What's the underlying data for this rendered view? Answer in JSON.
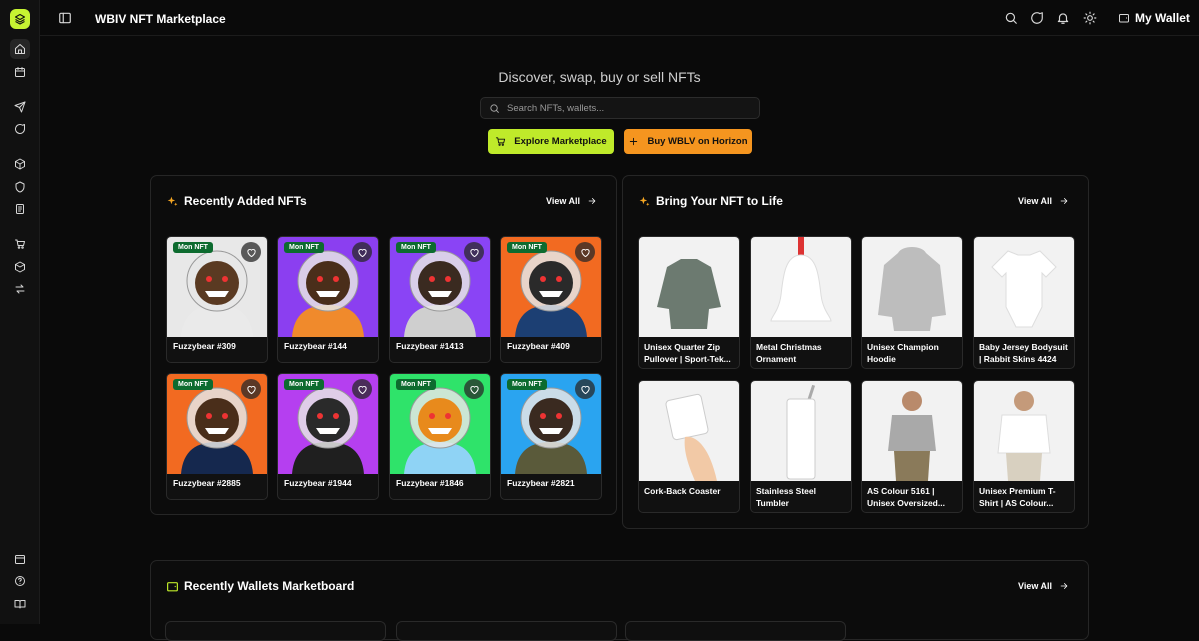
{
  "app": {
    "title": "WBIV NFT Marketplace",
    "wallet_label": "My Wallet"
  },
  "hero": {
    "title": "Discover, swap, buy or sell NFTs",
    "search_placeholder": "Search NFTs, wallets...",
    "explore_label": "Explore Marketplace",
    "buy_label": "Buy WBLV on Horizon"
  },
  "recent_nfts": {
    "title": "Recently Added NFTs",
    "view_all": "View All",
    "items": [
      {
        "name": "Fuzzybear #309",
        "badge": "Mon NFT",
        "bg": "#e8e8e8",
        "color": "#5a3a22",
        "suit": "#eaeaea"
      },
      {
        "name": "Fuzzybear #144",
        "badge": "Mon NFT",
        "bg": "#8b3ff0",
        "color": "#4a2e1a",
        "suit": "#f08a2c"
      },
      {
        "name": "Fuzzybear #1413",
        "badge": "Mon NFT",
        "bg": "#8a44f5",
        "color": "#3a2a20",
        "suit": "#cfcfcf"
      },
      {
        "name": "Fuzzybear #409",
        "badge": "Mon NFT",
        "bg": "#f26a21",
        "color": "#2a2a2a",
        "suit": "#1c3f73"
      },
      {
        "name": "Fuzzybear #2885",
        "badge": "Mon NFT",
        "bg": "#f26a21",
        "color": "#4a2e1a",
        "suit": "#15284e"
      },
      {
        "name": "Fuzzybear #1944",
        "badge": "Mon NFT",
        "bg": "#b53ff0",
        "color": "#2a2a2a",
        "suit": "#1f1f1f"
      },
      {
        "name": "Fuzzybear #1846",
        "badge": "Mon NFT",
        "bg": "#2fe36a",
        "color": "#e88a1c",
        "suit": "#8fd3f5"
      },
      {
        "name": "Fuzzybear #2821",
        "badge": "Mon NFT",
        "bg": "#2aa4f0",
        "color": "#3a2a20",
        "suit": "#5a5a3a"
      }
    ]
  },
  "products": {
    "title": "Bring Your NFT to Life",
    "view_all": "View All",
    "items": [
      {
        "name": "Unisex Quarter Zip Pullover | Sport-Tek...",
        "icon": "pullover-icon",
        "color": "#6c7a70"
      },
      {
        "name": "Metal Christmas Ornament",
        "icon": "ornament-icon",
        "color": "#ffffff"
      },
      {
        "name": "Unisex Champion Hoodie",
        "icon": "hoodie-icon",
        "color": "#bdbdbd"
      },
      {
        "name": "Baby Jersey Bodysuit | Rabbit Skins 4424",
        "icon": "bodysuit-icon",
        "color": "#ffffff"
      },
      {
        "name": "Cork-Back Coaster",
        "icon": "coaster-icon",
        "color": "#ffffff"
      },
      {
        "name": "Stainless Steel Tumbler",
        "icon": "tumbler-icon",
        "color": "#ffffff"
      },
      {
        "name": "AS Colour 5161 | Unisex Oversized...",
        "icon": "person-hoodie-icon",
        "color": "#a9a9a9"
      },
      {
        "name": "Unisex Premium T-Shirt | AS Colour...",
        "icon": "person-tshirt-icon",
        "color": "#ffffff"
      }
    ]
  },
  "marketboard": {
    "title": "Recently Wallets Marketboard",
    "view_all": "View All"
  },
  "colors": {
    "accent_green": "#bfea2a",
    "accent_orange": "#f5951f",
    "badge_green": "#0d6b2f"
  }
}
